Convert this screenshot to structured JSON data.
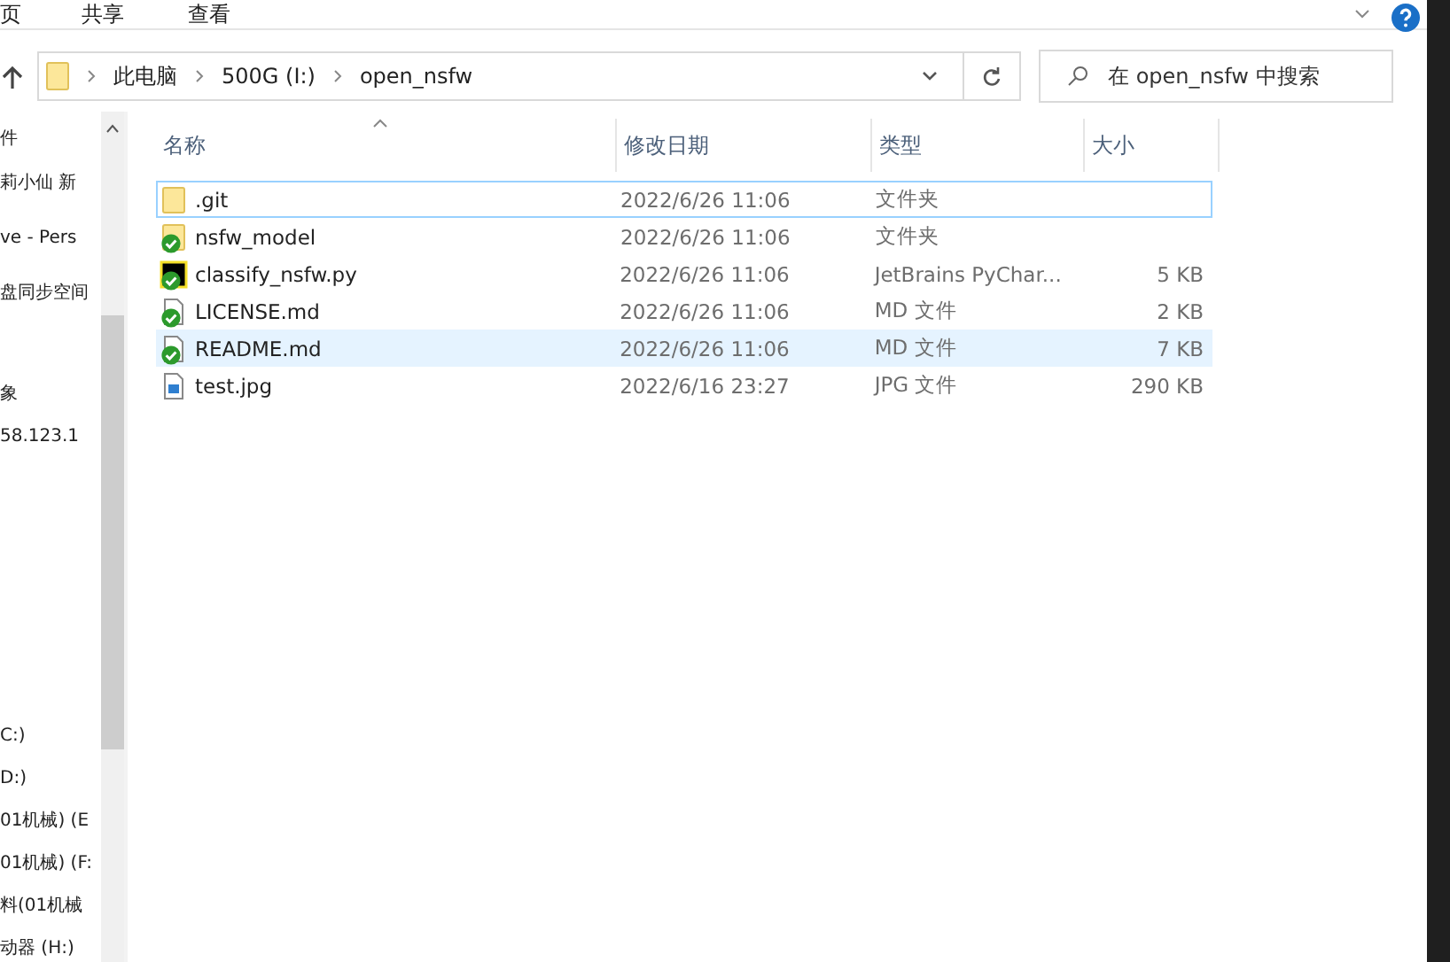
{
  "ribbon_tabs": [
    "页",
    "共享",
    "查看"
  ],
  "address": {
    "crumbs": [
      "此电脑",
      "500G (I:)",
      "open_nsfw"
    ]
  },
  "search": {
    "placeholder": "在 open_nsfw 中搜索"
  },
  "sidebar": {
    "items": [
      {
        "label": "件"
      },
      {
        "label": "莉小仙 新"
      },
      {
        "label": "ve - Pers"
      },
      {
        "label": "盘同步空间"
      },
      {
        "label": "象"
      },
      {
        "label": "58.123.1"
      },
      {
        "label": "C:)"
      },
      {
        "label": "D:)"
      },
      {
        "label": "01机械) (E"
      },
      {
        "label": "01机械) (F:"
      },
      {
        "label": "料(01机械"
      },
      {
        "label": "动器 (H:)"
      }
    ]
  },
  "table": {
    "columns": [
      "名称",
      "修改日期",
      "类型",
      "大小"
    ],
    "rows": [
      {
        "kind": "folder",
        "name": ".git",
        "date": "2022/6/26 11:06",
        "type": "文件夹",
        "focused": true,
        "highlighted": false,
        "synced": false
      },
      {
        "kind": "folder",
        "name": "nsfw_model",
        "date": "2022/6/26 11:06",
        "type": "文件夹",
        "focused": false,
        "highlighted": false,
        "synced": true
      },
      {
        "kind": "pycharm",
        "name": "classify_nsfw.py",
        "date": "2022/6/26 11:06",
        "type": "JetBrains PyChar...",
        "size": "5 KB",
        "focused": false,
        "highlighted": false,
        "synced": true
      },
      {
        "kind": "file",
        "name": "LICENSE.md",
        "date": "2022/6/26 11:06",
        "type": "MD 文件",
        "size": "2 KB",
        "focused": false,
        "highlighted": false,
        "synced": true
      },
      {
        "kind": "file",
        "name": "README.md",
        "date": "2022/6/26 11:06",
        "type": "MD 文件",
        "size": "7 KB",
        "focused": false,
        "highlighted": true,
        "synced": true
      },
      {
        "kind": "image",
        "name": "test.jpg",
        "date": "2022/6/16 23:27",
        "type": "JPG 文件",
        "size": "290 KB",
        "focused": false,
        "highlighted": false,
        "synced": false
      }
    ]
  }
}
